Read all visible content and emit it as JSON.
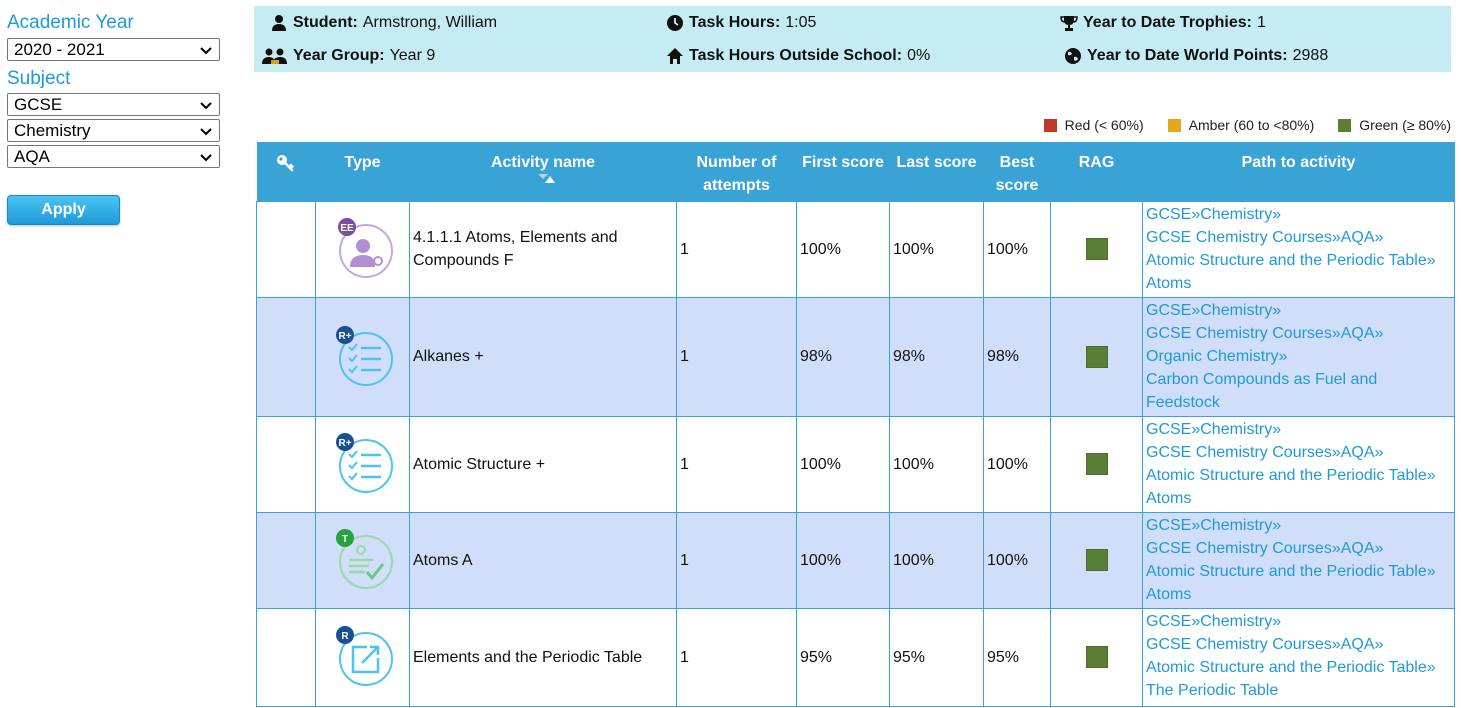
{
  "filters": {
    "academic_year_label": "Academic Year",
    "academic_year_value": "2020 - 2021",
    "subject_label": "Subject",
    "subject_values": [
      "GCSE",
      "Chemistry",
      "AQA"
    ],
    "apply_label": "Apply"
  },
  "info": {
    "student_label": "Student:",
    "student_value": "Armstrong, William",
    "task_hours_label": "Task Hours:",
    "task_hours_value": "1:05",
    "trophies_label": "Year to Date Trophies:",
    "trophies_value": "1",
    "year_group_label": "Year Group:",
    "year_group_value": "Year 9",
    "outside_label": "Task Hours Outside School:",
    "outside_value": "0%",
    "world_points_label": "Year to Date World Points:",
    "world_points_value": "2988"
  },
  "legend": [
    {
      "label": "Red (< 60%)",
      "color": "#c0392b"
    },
    {
      "label": "Amber (60 to <80%)",
      "color": "#e8a620"
    },
    {
      "label": "Green (≥ 80%)",
      "color": "#5a7e35"
    }
  ],
  "table": {
    "headers": {
      "key_icon": "key-icon",
      "type": "Type",
      "activity": "Activity name",
      "attempts_1": "Number of",
      "attempts_2": "attempts",
      "first": "First score",
      "last": "Last score",
      "best_1": "Best",
      "best_2": "score",
      "rag": "RAG",
      "path": "Path to activity"
    },
    "rows": [
      {
        "type_badge": "EE",
        "type_icon": "expert-user-icon",
        "badge_color": "#7b4ea0",
        "activity": "4.1.1.1 Atoms, Elements and Compounds F",
        "attempts": "1",
        "first": "100%",
        "last": "100%",
        "best": "100%",
        "rag": "green",
        "path": [
          "GCSE»Chemistry»",
          "GCSE Chemistry Courses»AQA»",
          "Atomic Structure and the Periodic Table»",
          "Atoms"
        ]
      },
      {
        "type_badge": "R+",
        "type_icon": "checklist-icon",
        "badge_color": "#1b4f94",
        "activity": "Alkanes +",
        "attempts": "1",
        "first": "98%",
        "last": "98%",
        "best": "98%",
        "rag": "green",
        "path": [
          "GCSE»Chemistry»",
          "GCSE Chemistry Courses»AQA»",
          "Organic Chemistry»",
          "Carbon Compounds as Fuel and",
          "Feedstock"
        ]
      },
      {
        "type_badge": "R+",
        "type_icon": "checklist-icon",
        "badge_color": "#1b4f94",
        "activity": "Atomic Structure +",
        "attempts": "1",
        "first": "100%",
        "last": "100%",
        "best": "100%",
        "rag": "green",
        "path": [
          "GCSE»Chemistry»",
          "GCSE Chemistry Courses»AQA»",
          "Atomic Structure and the Periodic Table»",
          "Atoms"
        ]
      },
      {
        "type_badge": "T",
        "type_icon": "test-check-icon",
        "badge_color": "#27a243",
        "activity": "Atoms A",
        "attempts": "1",
        "first": "100%",
        "last": "100%",
        "best": "100%",
        "rag": "green",
        "path": [
          "GCSE»Chemistry»",
          "GCSE Chemistry Courses»AQA»",
          "Atomic Structure and the Periodic Table»",
          "Atoms"
        ]
      },
      {
        "type_badge": "R",
        "type_icon": "external-link-icon",
        "badge_color": "#1b4f94",
        "activity": "Elements and the Periodic Table",
        "attempts": "1",
        "first": "95%",
        "last": "95%",
        "best": "95%",
        "rag": "green",
        "path": [
          "GCSE»Chemistry»",
          "GCSE Chemistry Courses»AQA»",
          "Atomic Structure and the Periodic Table»",
          "The Periodic Table"
        ]
      }
    ]
  }
}
